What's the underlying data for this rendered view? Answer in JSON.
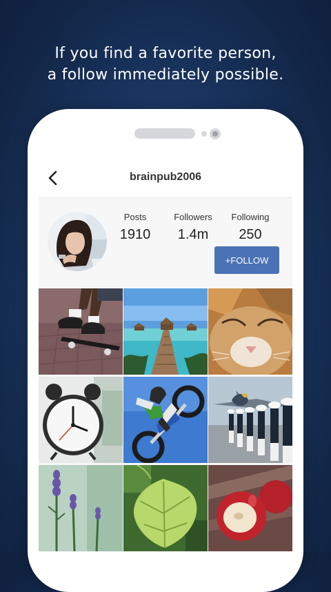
{
  "headline": {
    "line1": "If you find a favorite person,",
    "line2": "a follow immediately possible."
  },
  "profile": {
    "username": "brainpub2006",
    "stats": [
      {
        "label": "Posts",
        "value": "1910"
      },
      {
        "label": "Followers",
        "value": "1.4m"
      },
      {
        "label": "Following",
        "value": "250"
      }
    ],
    "follow_label": "+FOLLOW"
  },
  "colors": {
    "background": "#1b3763",
    "follow_button": "#4a73b5"
  },
  "icons": {
    "back": "chevron-left-icon"
  },
  "photos": [
    "skateboard",
    "beach-bungalows",
    "cat",
    "alarm-clock",
    "motocross",
    "marching-soldiers",
    "lavender",
    "green-leaf",
    "red-apples"
  ]
}
